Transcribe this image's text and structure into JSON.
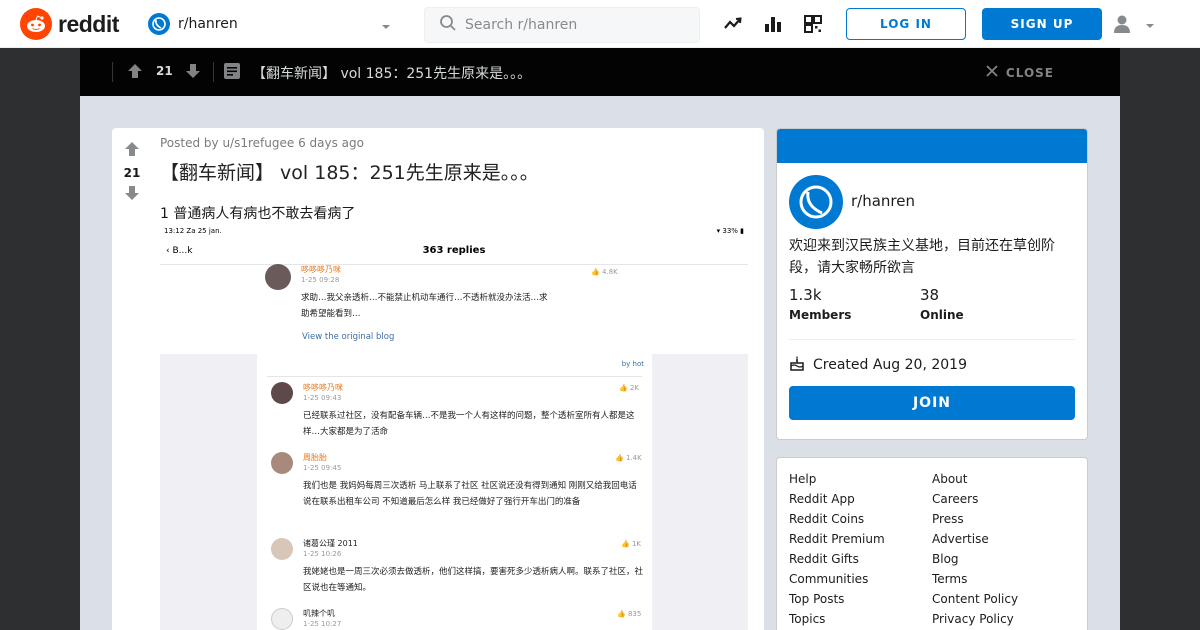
{
  "header": {
    "logo_text": "reddit",
    "community": "r/hanren",
    "search_placeholder": "Search r/hanren",
    "login_label": "LOG IN",
    "signup_label": "SIGN UP",
    "icons": [
      "trending-icon",
      "stats-icon",
      "qr-code-icon",
      "user-icon",
      "chevron-down-icon"
    ]
  },
  "post_bar": {
    "score": "21",
    "title": "【翻车新闻】 vol 185：251先生原来是。。。",
    "close_label": "CLOSE"
  },
  "post": {
    "meta": "Posted by u/s1refugee 6 days ago",
    "score": "21",
    "title": "【翻车新闻】 vol 185：251先生原来是。。。",
    "body": "1 普通病人有病也不敢去看病了",
    "screenshot": {
      "status_time": "13:12  Za 25 jan.",
      "status_right": "33%",
      "back": "B...k",
      "replies": "363 replies",
      "view_original": "View the original blog",
      "by_hot": "by hot",
      "comments": [
        {
          "name": "哆哆哆乃咪",
          "time": "1-25 09:28",
          "likes": "4.8K",
          "text": "求助…我父亲透析…不能禁止机动车通行…不透析就没办法活…求助希望能看到…"
        },
        {
          "name": "哆哆哆乃咪",
          "time": "1-25 09:43",
          "likes": "2K",
          "text": "已经联系过社区，没有配备车辆…不是我一个人有这样的问题，整个透析室所有人都是这样…大家都是为了活命"
        },
        {
          "name": "周胎胎",
          "time": "1-25 09:45",
          "likes": "1.4K",
          "text": "我们也是 我妈妈每周三次透析 马上联系了社区 社区说还没有得到通知 刚刚又给我回电话 说在联系出租车公司 不知道最后怎么样 我已经做好了强行开车出门的准备"
        },
        {
          "name": "诸葛公瑾 2011",
          "time": "1-25 10:26",
          "likes": "1K",
          "text": "我姥姥也是一周三次必须去做透析，他们这样搞，要害死多少透析病人啊。联系了社区，社区说也在等通知。"
        },
        {
          "name": "叽辣个叽",
          "time": "1-25 10:27",
          "likes": "835",
          "text": ""
        }
      ]
    }
  },
  "sidebar": {
    "name": "r/hanren",
    "description": "欢迎来到汉民族主义基地，目前还在草创阶段，请大家畅所欲言",
    "members_count": "1.3k",
    "members_label": "Members",
    "online_count": "38",
    "online_label": "Online",
    "created": "Created Aug 20, 2019",
    "join_label": "JOIN",
    "accent": "#0079d3"
  },
  "footer_links": {
    "left": [
      "Help",
      "Reddit App",
      "Reddit Coins",
      "Reddit Premium",
      "Reddit Gifts",
      "Communities",
      "Top Posts",
      "Topics"
    ],
    "right": [
      "About",
      "Careers",
      "Press",
      "Advertise",
      "Blog",
      "Terms",
      "Content Policy",
      "Privacy Policy"
    ]
  }
}
